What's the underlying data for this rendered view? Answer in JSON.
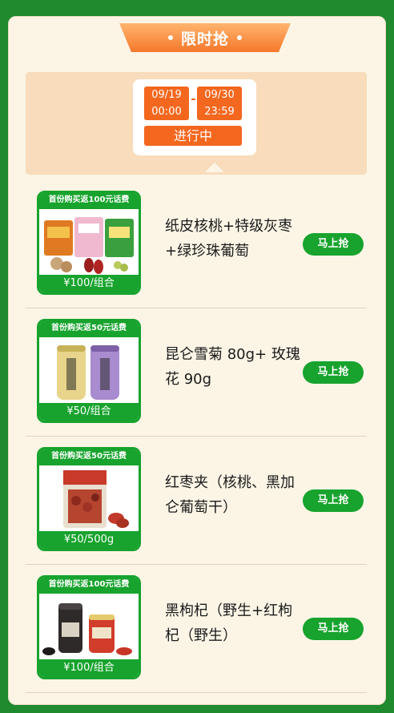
{
  "banner": {
    "title": "限时抢"
  },
  "time": {
    "start_date": "09/19",
    "start_time": "00:00",
    "end_date": "09/30",
    "end_time": "23:59",
    "status": "进行中"
  },
  "products": [
    {
      "tag": "首份购买返100元话费",
      "title": "纸皮核桃+特级灰枣+绿珍珠葡萄",
      "price": "¥100/组合",
      "button": "马上抢",
      "icon": "snack-bags-image"
    },
    {
      "tag": "首份购买返50元话费",
      "title": "昆仑雪菊 80g+ 玫瑰花 90g",
      "price": "¥50/组合",
      "button": "马上抢",
      "icon": "tea-jars-image"
    },
    {
      "tag": "首份购买返50元话费",
      "title": "红枣夹（核桃、黑加仑葡萄干）",
      "price": "¥50/500g",
      "button": "马上抢",
      "icon": "jujube-bag-image"
    },
    {
      "tag": "首份购买返100元话费",
      "title": "黑枸杞（野生+红枸杞（野生）",
      "price": "¥100/组合",
      "button": "马上抢",
      "icon": "goji-jars-image"
    }
  ],
  "colors": {
    "accent": "#f4671e",
    "green": "#17a32d",
    "background": "#1f8a2e"
  }
}
